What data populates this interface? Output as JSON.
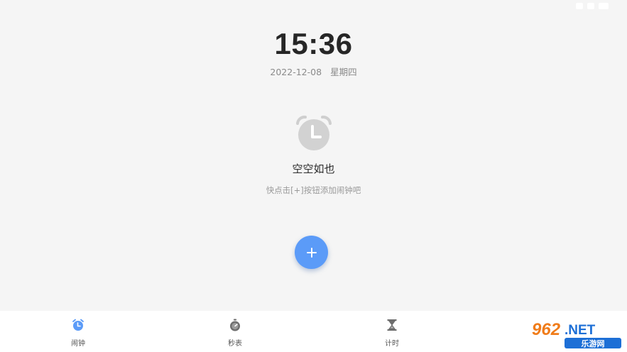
{
  "clock": {
    "time": "15:36",
    "date": "2022-12-08",
    "weekday": "星期四"
  },
  "empty_state": {
    "icon": "alarm-clock-icon",
    "title": "空空如也",
    "hint": "快点击[+]按钮添加闹钟吧"
  },
  "fab": {
    "icon": "plus-icon",
    "color": "#5b9bf8"
  },
  "bottom_nav": {
    "items": [
      {
        "label": "闹钟",
        "icon": "alarm-icon",
        "active": true,
        "color": "#5b9bf8"
      },
      {
        "label": "秒表",
        "icon": "stopwatch-icon",
        "active": false,
        "color": "#6e6e6e"
      },
      {
        "label": "计时",
        "icon": "hourglass-icon",
        "active": false,
        "color": "#6e6e6e"
      }
    ]
  },
  "watermark": {
    "brand": "962.NET",
    "subtitle": "乐游网"
  }
}
